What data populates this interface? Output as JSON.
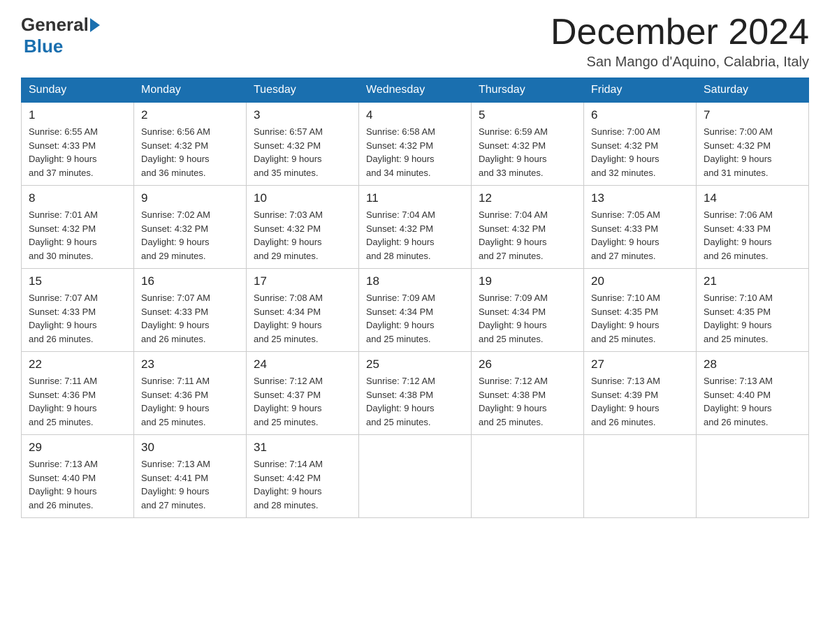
{
  "logo": {
    "general": "General",
    "blue": "Blue"
  },
  "header": {
    "month": "December 2024",
    "location": "San Mango d'Aquino, Calabria, Italy"
  },
  "weekdays": [
    "Sunday",
    "Monday",
    "Tuesday",
    "Wednesday",
    "Thursday",
    "Friday",
    "Saturday"
  ],
  "weeks": [
    [
      {
        "day": "1",
        "sunrise": "6:55 AM",
        "sunset": "4:33 PM",
        "daylight": "9 hours and 37 minutes."
      },
      {
        "day": "2",
        "sunrise": "6:56 AM",
        "sunset": "4:32 PM",
        "daylight": "9 hours and 36 minutes."
      },
      {
        "day": "3",
        "sunrise": "6:57 AM",
        "sunset": "4:32 PM",
        "daylight": "9 hours and 35 minutes."
      },
      {
        "day": "4",
        "sunrise": "6:58 AM",
        "sunset": "4:32 PM",
        "daylight": "9 hours and 34 minutes."
      },
      {
        "day": "5",
        "sunrise": "6:59 AM",
        "sunset": "4:32 PM",
        "daylight": "9 hours and 33 minutes."
      },
      {
        "day": "6",
        "sunrise": "7:00 AM",
        "sunset": "4:32 PM",
        "daylight": "9 hours and 32 minutes."
      },
      {
        "day": "7",
        "sunrise": "7:00 AM",
        "sunset": "4:32 PM",
        "daylight": "9 hours and 31 minutes."
      }
    ],
    [
      {
        "day": "8",
        "sunrise": "7:01 AM",
        "sunset": "4:32 PM",
        "daylight": "9 hours and 30 minutes."
      },
      {
        "day": "9",
        "sunrise": "7:02 AM",
        "sunset": "4:32 PM",
        "daylight": "9 hours and 29 minutes."
      },
      {
        "day": "10",
        "sunrise": "7:03 AM",
        "sunset": "4:32 PM",
        "daylight": "9 hours and 29 minutes."
      },
      {
        "day": "11",
        "sunrise": "7:04 AM",
        "sunset": "4:32 PM",
        "daylight": "9 hours and 28 minutes."
      },
      {
        "day": "12",
        "sunrise": "7:04 AM",
        "sunset": "4:32 PM",
        "daylight": "9 hours and 27 minutes."
      },
      {
        "day": "13",
        "sunrise": "7:05 AM",
        "sunset": "4:33 PM",
        "daylight": "9 hours and 27 minutes."
      },
      {
        "day": "14",
        "sunrise": "7:06 AM",
        "sunset": "4:33 PM",
        "daylight": "9 hours and 26 minutes."
      }
    ],
    [
      {
        "day": "15",
        "sunrise": "7:07 AM",
        "sunset": "4:33 PM",
        "daylight": "9 hours and 26 minutes."
      },
      {
        "day": "16",
        "sunrise": "7:07 AM",
        "sunset": "4:33 PM",
        "daylight": "9 hours and 26 minutes."
      },
      {
        "day": "17",
        "sunrise": "7:08 AM",
        "sunset": "4:34 PM",
        "daylight": "9 hours and 25 minutes."
      },
      {
        "day": "18",
        "sunrise": "7:09 AM",
        "sunset": "4:34 PM",
        "daylight": "9 hours and 25 minutes."
      },
      {
        "day": "19",
        "sunrise": "7:09 AM",
        "sunset": "4:34 PM",
        "daylight": "9 hours and 25 minutes."
      },
      {
        "day": "20",
        "sunrise": "7:10 AM",
        "sunset": "4:35 PM",
        "daylight": "9 hours and 25 minutes."
      },
      {
        "day": "21",
        "sunrise": "7:10 AM",
        "sunset": "4:35 PM",
        "daylight": "9 hours and 25 minutes."
      }
    ],
    [
      {
        "day": "22",
        "sunrise": "7:11 AM",
        "sunset": "4:36 PM",
        "daylight": "9 hours and 25 minutes."
      },
      {
        "day": "23",
        "sunrise": "7:11 AM",
        "sunset": "4:36 PM",
        "daylight": "9 hours and 25 minutes."
      },
      {
        "day": "24",
        "sunrise": "7:12 AM",
        "sunset": "4:37 PM",
        "daylight": "9 hours and 25 minutes."
      },
      {
        "day": "25",
        "sunrise": "7:12 AM",
        "sunset": "4:38 PM",
        "daylight": "9 hours and 25 minutes."
      },
      {
        "day": "26",
        "sunrise": "7:12 AM",
        "sunset": "4:38 PM",
        "daylight": "9 hours and 25 minutes."
      },
      {
        "day": "27",
        "sunrise": "7:13 AM",
        "sunset": "4:39 PM",
        "daylight": "9 hours and 26 minutes."
      },
      {
        "day": "28",
        "sunrise": "7:13 AM",
        "sunset": "4:40 PM",
        "daylight": "9 hours and 26 minutes."
      }
    ],
    [
      {
        "day": "29",
        "sunrise": "7:13 AM",
        "sunset": "4:40 PM",
        "daylight": "9 hours and 26 minutes."
      },
      {
        "day": "30",
        "sunrise": "7:13 AM",
        "sunset": "4:41 PM",
        "daylight": "9 hours and 27 minutes."
      },
      {
        "day": "31",
        "sunrise": "7:14 AM",
        "sunset": "4:42 PM",
        "daylight": "9 hours and 28 minutes."
      },
      null,
      null,
      null,
      null
    ]
  ],
  "labels": {
    "sunrise": "Sunrise:",
    "sunset": "Sunset:",
    "daylight": "Daylight:"
  }
}
